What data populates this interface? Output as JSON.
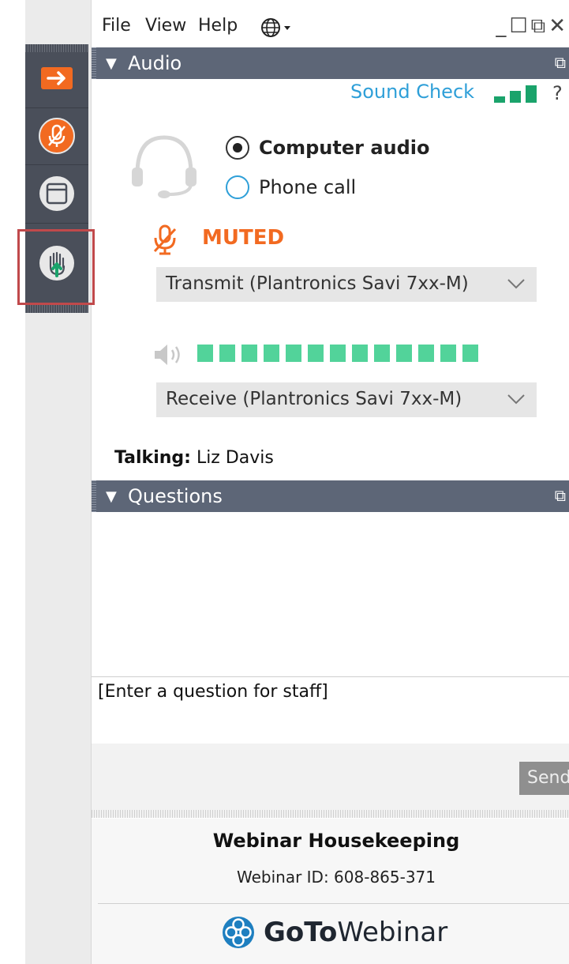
{
  "menu": {
    "file": "File",
    "view": "View",
    "help": "Help",
    "window_controls": "_☐⧉✕"
  },
  "audio_panel": {
    "title": "Audio",
    "sound_check": "Sound Check",
    "help": "?",
    "options": [
      {
        "label": "Computer audio",
        "selected": true
      },
      {
        "label": "Phone call",
        "selected": false
      }
    ],
    "muted_label": "MUTED",
    "transmit_device": "Transmit (Plantronics Savi 7xx-M)",
    "receive_device": "Receive (Plantronics Savi 7xx-M)",
    "output_level_segments": 13,
    "talking_label": "Talking:",
    "talking_name": "Liz Davis"
  },
  "questions_panel": {
    "title": "Questions",
    "input_placeholder": "[Enter a question for staff]",
    "send_label": "Send"
  },
  "footer": {
    "title": "Webinar Housekeeping",
    "webinar_id": "Webinar ID: 608-865-371",
    "logo_bold": "GoTo",
    "logo_regular": "Webinar"
  },
  "colors": {
    "accent_orange": "#f26a21",
    "link_blue": "#2e9fd8",
    "level_green": "#52d39a",
    "header_slate": "#5d6677",
    "toolbar_dark": "#4a4f5a",
    "highlight_red": "#c0494b"
  },
  "icons": {
    "toolbar": [
      "arrow-right-icon",
      "mic-muted-icon",
      "window-icon",
      "raise-hand-icon"
    ],
    "language": "globe-icon"
  }
}
